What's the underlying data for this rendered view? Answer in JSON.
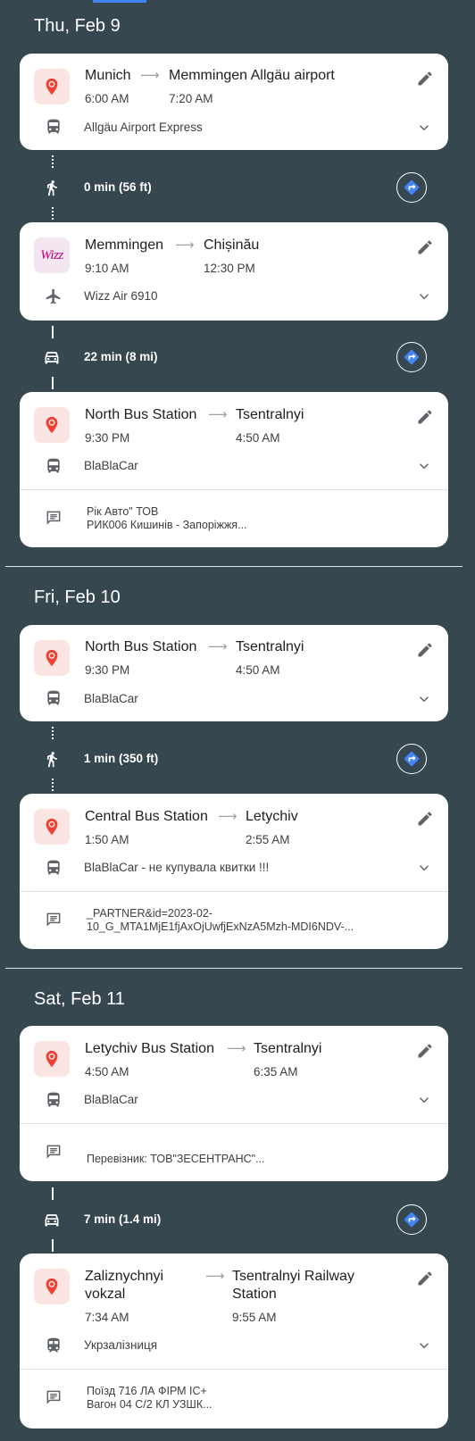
{
  "days": [
    {
      "label": "Thu, Feb 9"
    },
    {
      "label": "Fri, Feb 10"
    },
    {
      "label": "Sat, Feb 11"
    }
  ],
  "segments": [
    {
      "from": "Munich",
      "to": "Memmingen Allgäu airport",
      "depart": "6:00 AM",
      "arrive": "7:20 AM",
      "carrier": "Allgäu Airport Express",
      "icon": "bus-icon",
      "badge": "map-pin-icon"
    },
    {
      "from": "Memmingen",
      "to": "Chișinău",
      "depart": "9:10 AM",
      "arrive": "12:30 PM",
      "carrier": "Wizz Air 6910",
      "icon": "plane-icon",
      "badge": "wizz-air-logo",
      "logo_text": "Wizz"
    },
    {
      "from": "North Bus Station",
      "to": "Tsentralnyi",
      "depart": "9:30 PM",
      "arrive": "4:50 AM",
      "carrier": "BlaBlaCar",
      "icon": "bus-icon",
      "badge": "map-pin-icon",
      "note": "Рік Авто\" ТОВ\nРИК006 Кишинів - Запоріжжя..."
    },
    {
      "from": "North Bus Station",
      "to": "Tsentralnyi",
      "depart": "9:30 PM",
      "arrive": "4:50 AM",
      "carrier": "BlaBlaCar",
      "icon": "bus-icon",
      "badge": "map-pin-icon"
    },
    {
      "from": "Central Bus Station",
      "to": "Letychiv",
      "depart": "1:50 AM",
      "arrive": "2:55 AM",
      "carrier": "BlaBlaCar - не купувала квитки !!!",
      "icon": "bus-icon",
      "badge": "map-pin-icon",
      "note": "_PARTNER&id=2023-02-\n10_G_MTA1MjE1fjAxOjUwfjExNzA5Mzh-MDI6NDV-..."
    },
    {
      "from": "Letychiv Bus Station",
      "to": "Tsentralnyi",
      "depart": "4:50 AM",
      "arrive": "6:35 AM",
      "carrier": "BlaBlaCar",
      "icon": "bus-icon",
      "badge": "map-pin-icon",
      "note": "Перевізник: ТОВ\"ЗЕСЕНТРАНС\"..."
    },
    {
      "from": "Zaliznychnyi\nvokzal",
      "to": "Tsentralnyi Railway\nStation",
      "depart": "7:34 AM",
      "arrive": "9:55 AM",
      "carrier": "Укрзалізниця",
      "icon": "train-icon",
      "badge": "map-pin-icon",
      "note": "Поїзд 716 ЛА ФІРМ IC+\nВагон 04 С/2 КЛ УЗШК..."
    }
  ],
  "connections": [
    {
      "mode": "walk-icon",
      "text": "0 min (56 ft)"
    },
    {
      "mode": "car-icon",
      "text": "22 min (8 mi)"
    },
    {
      "mode": "walk-icon",
      "text": "1 min (350 ft)"
    },
    {
      "mode": "car-icon",
      "text": "7 min (1.4 mi)"
    }
  ],
  "colors": {
    "background": "#37474f",
    "card": "#ffffff",
    "pin": "#ea4335",
    "directions": "#4285f4"
  }
}
